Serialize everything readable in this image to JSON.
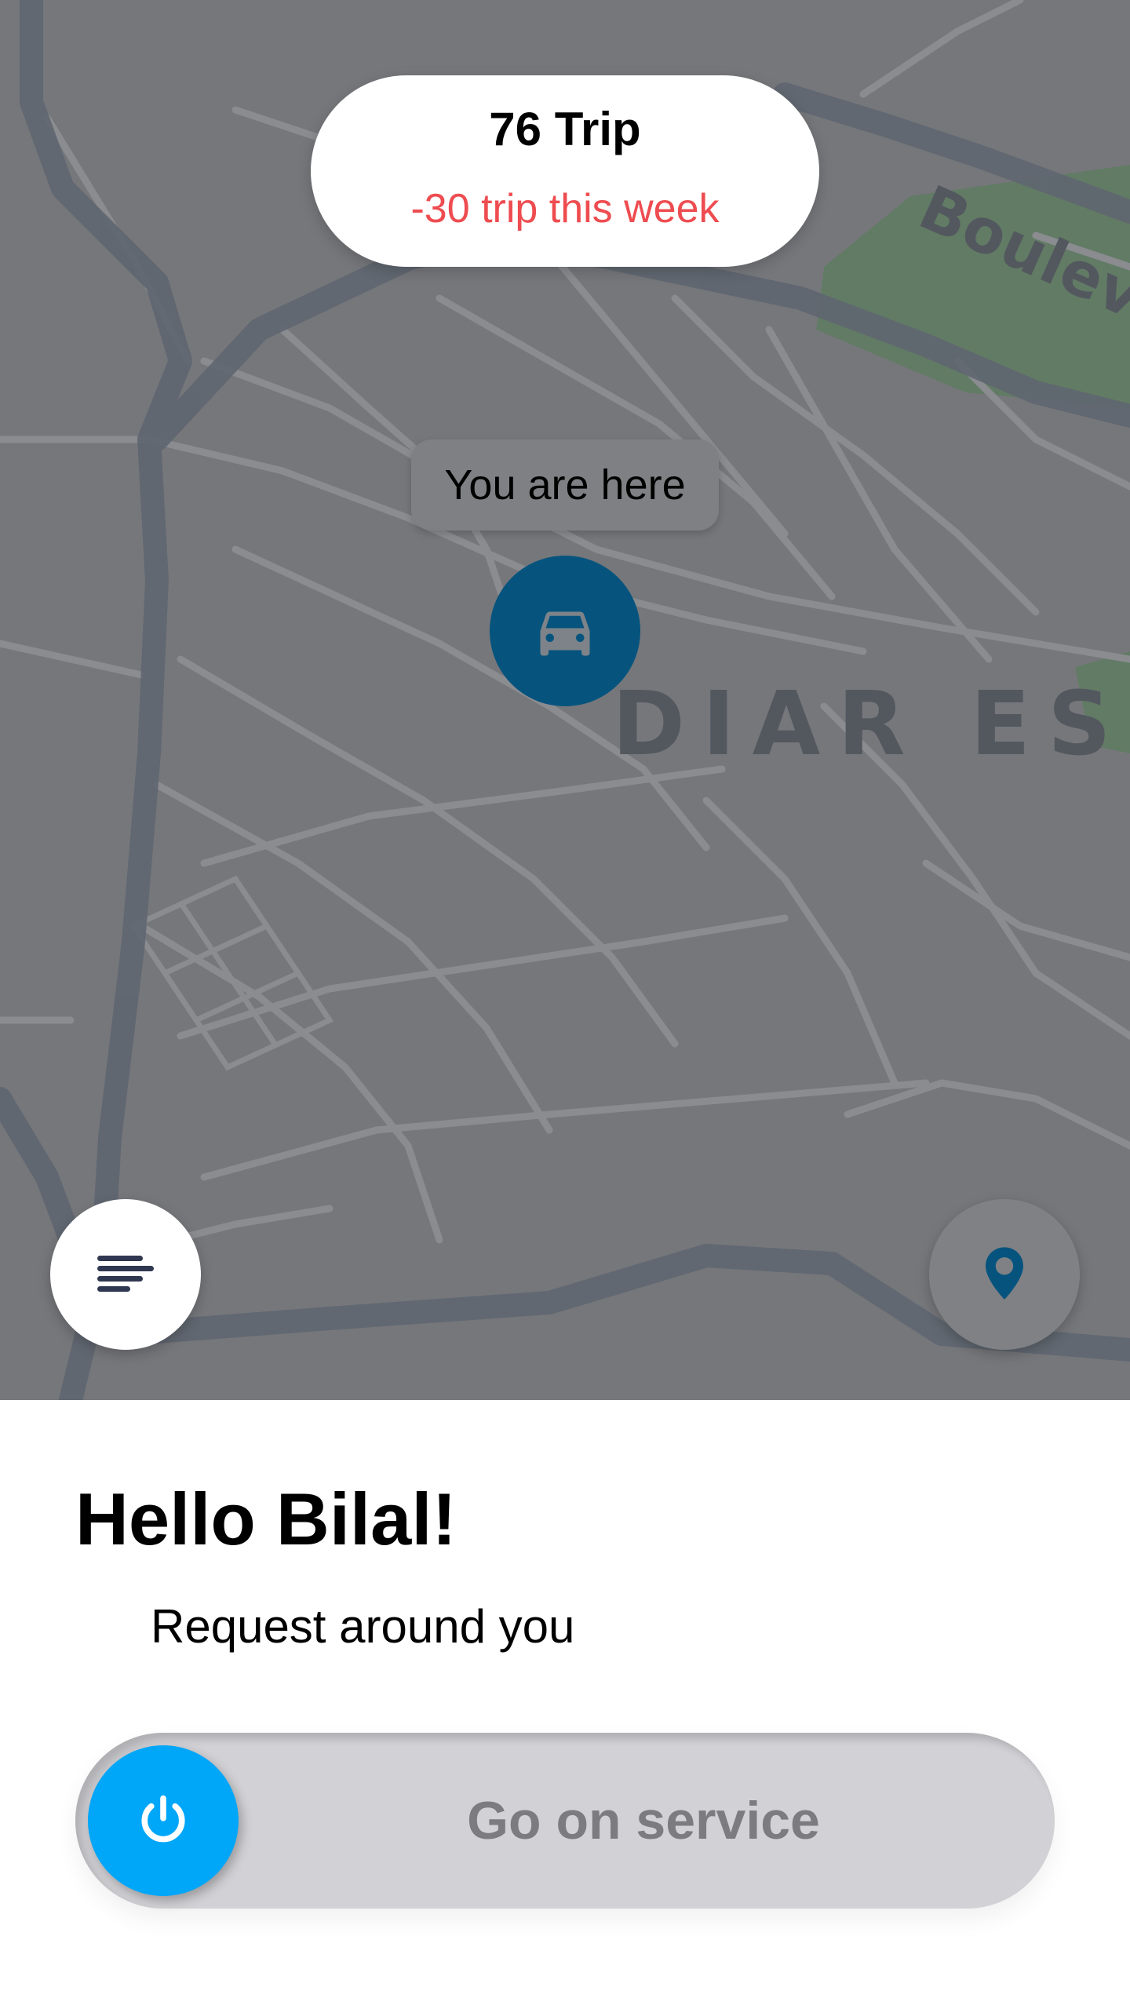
{
  "map": {
    "district_label": "DIAR ES S",
    "street_label": "Boulev",
    "here_label": "You are here",
    "colors": {
      "base": "#76777b",
      "roads": "#8a8c90",
      "main_roads": "#5f6670",
      "park": "#5f7b62",
      "marker": "#06547e"
    }
  },
  "trip": {
    "count": "76 Trip",
    "delta": "-30 trip this week",
    "delta_color": "#ee4c50"
  },
  "buttons": {
    "menu_icon": "menu-lines-icon",
    "location_icon": "location-pin-icon"
  },
  "sheet": {
    "greeting": "Hello Bilal!",
    "subtext": "Request around you",
    "service_label": "Go on service",
    "power_icon": "power-icon",
    "accent": "#00a6f8"
  }
}
